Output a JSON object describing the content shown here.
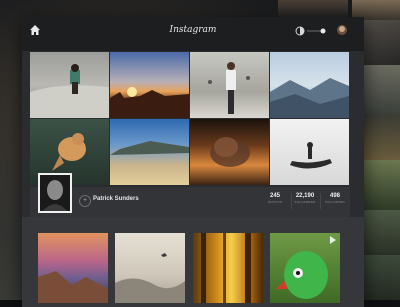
{
  "app": {
    "title": "Instagram"
  },
  "profile": {
    "name": "Patrick Sunders",
    "follow_symbol": "+",
    "stats": [
      {
        "value": "245",
        "label": "PHOTOS"
      },
      {
        "value": "22,190",
        "label": "FOLLOWERS"
      },
      {
        "value": "498",
        "label": "FOLLOWING"
      }
    ]
  },
  "icons": {
    "home": "home-icon",
    "toggle": "toggle-switch",
    "avatar": "user-avatar",
    "play": "play-icon"
  },
  "grid_photos": [
    "boy-sitting-on-beach",
    "desert-sunset",
    "man-feeding-birds",
    "misty-mountains",
    "jumping-lion-cub",
    "sandy-beach-coast",
    "volcanic-sunset-smoke",
    "jet-ski-rider"
  ],
  "feed_photos": [
    "sunset-coastal-cliffs",
    "foggy-sea-with-birds",
    "autumn-forest-sunlight",
    "green-parrot"
  ],
  "colors": {
    "window": "#2b2c2f",
    "topbar": "#1d1e20",
    "profile_bar": "#323438",
    "feed": "#36373b"
  }
}
